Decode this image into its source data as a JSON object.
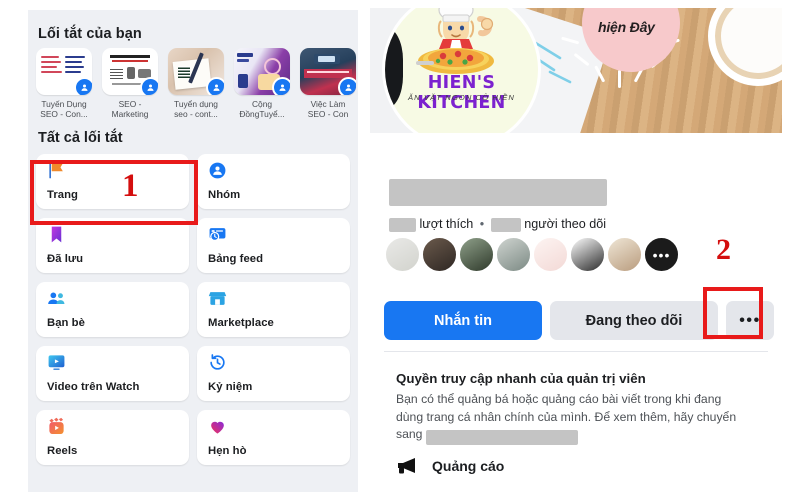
{
  "left_panel": {
    "shortcuts_title": "Lối tắt của bạn",
    "all_shortcuts_title": "Tất cả lối tắt",
    "shortcuts": [
      {
        "label": "Tuyến Dụng\nSEO - Con...",
        "badge_icon": "group-icon"
      },
      {
        "label": "SEO -\nMarketing",
        "badge_icon": "group-icon"
      },
      {
        "label": "Tuyển dụng\nseo - cont...",
        "badge_icon": "group-icon"
      },
      {
        "label": "Cộng\nĐồngTuyể...",
        "badge_icon": "group-icon"
      },
      {
        "label": "Việc Làm\nSEO - Con",
        "badge_icon": "group-icon"
      }
    ],
    "menu_items": [
      {
        "label": "Trang",
        "icon": "flag-icon"
      },
      {
        "label": "Nhóm",
        "icon": "groups-icon"
      },
      {
        "label": "Đã lưu",
        "icon": "bookmark-icon"
      },
      {
        "label": "Bảng feed",
        "icon": "feeds-icon"
      },
      {
        "label": "Bạn bè",
        "icon": "friends-icon"
      },
      {
        "label": "Marketplace",
        "icon": "marketplace-icon"
      },
      {
        "label": "Video trên Watch",
        "icon": "watch-icon"
      },
      {
        "label": "Kỷ niệm",
        "icon": "memories-clock-icon"
      },
      {
        "label": "Reels",
        "icon": "reels-icon"
      },
      {
        "label": "Hẹn hò",
        "icon": "dating-heart-icon"
      }
    ]
  },
  "right_panel": {
    "cover": {
      "sun_text": "hiện Đây"
    },
    "avatar": {
      "title": "HIEN'S KITCHEN",
      "subtitle": "ĂN VẶT NGON CÔ HIỀN"
    },
    "page_name_redacted": true,
    "stats": {
      "likes_label": "lượt thích",
      "separator": "•",
      "followers_label": "người theo dõi"
    },
    "faces_overflow_label": "•••",
    "buttons": {
      "message": "Nhắn tin",
      "following": "Đang theo dõi",
      "more": "•••"
    },
    "admin_section": {
      "title": "Quyền truy cập nhanh của quản trị viên",
      "body_part1": "Bạn có thể quảng bá hoặc quảng cáo bài viết trong khi đang dùng trang cá nhân chính của mình. Để xem thêm, hãy chuyển sang",
      "ad_label": "Quảng cáo",
      "ad_icon": "megaphone-icon"
    }
  },
  "annotations": {
    "step_1": "1",
    "step_2": "2",
    "highlight_color": "#e81a1a"
  }
}
